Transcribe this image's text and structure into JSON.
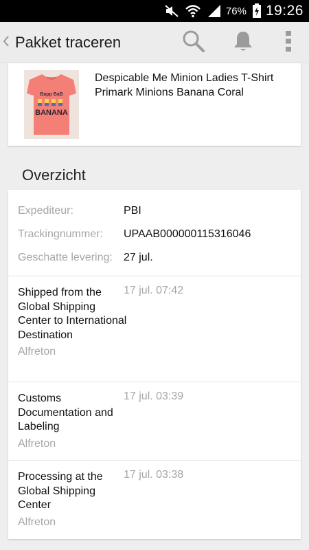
{
  "status_bar": {
    "battery_percent": "76%",
    "time": "19:26",
    "icons": [
      "mute-icon",
      "wifi-icon",
      "signal-icon",
      "battery-charging-icon"
    ]
  },
  "action_bar": {
    "title": "Pakket traceren",
    "actions": [
      "search-icon",
      "bell-icon",
      "overflow-menu-icon"
    ]
  },
  "product": {
    "title": "Despicable Me Minion Ladies T-Shirt Primark Minions Banana Coral",
    "image_colors": {
      "shirt": "#f47f76",
      "background": "#efe4dd"
    },
    "image_text": "BANANA"
  },
  "overview": {
    "section_title": "Overzicht",
    "fields": [
      {
        "label": "Expediteur:",
        "value": "PBI"
      },
      {
        "label": "Trackingnummer:",
        "value": "UPAAB000000115316046"
      },
      {
        "label": "Geschatte levering:",
        "value": "27 jul."
      }
    ]
  },
  "events": [
    {
      "description": "Shipped from the Global Shipping Center to International Destination",
      "location": "Alfreton",
      "time": "17 jul. 07:42"
    },
    {
      "description": "Customs Documentation and Labeling",
      "location": "Alfreton",
      "time": "17 jul. 03:39"
    },
    {
      "description": "Processing at the Global Shipping Center",
      "location": "Alfreton",
      "time": "17 jul. 03:38"
    }
  ]
}
